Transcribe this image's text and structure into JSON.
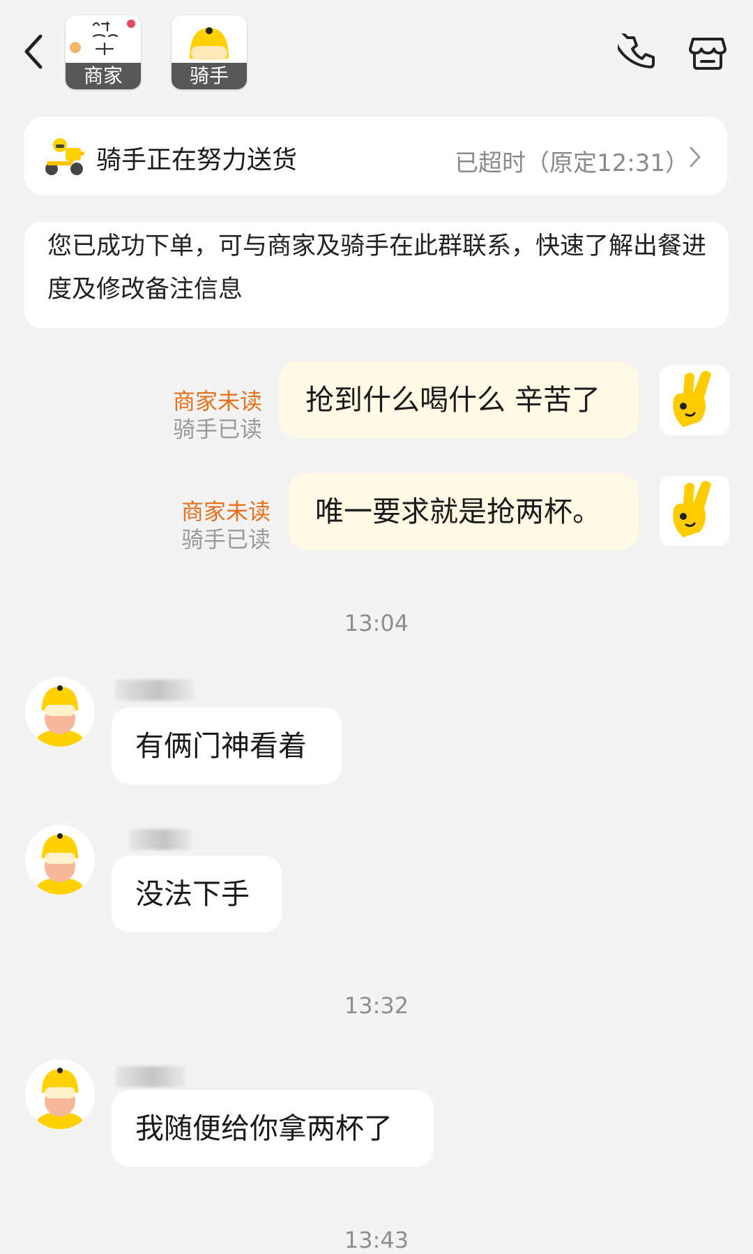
{
  "header": {
    "merchant_tab_label": "商家",
    "merchant_logo_text": "你是我心里的第一位",
    "rider_tab_label": "骑手",
    "icons": [
      "back-icon",
      "phone-icon",
      "store-icon"
    ]
  },
  "status": {
    "title": "骑手正在努力送货",
    "overdue_text": "已超时（原定12:31）",
    "accent_color": "#ffcc00"
  },
  "system_message": "您已成功下单，可与商家及骑手在此群联系，快速了解出餐进度及修改备注信息",
  "messages": [
    {
      "type": "out",
      "text": "抢到什么喝什么 辛苦了",
      "merchant_status": "商家未读",
      "rider_status": "骑手已读"
    },
    {
      "type": "out",
      "text": "唯一要求就是抢两杯。",
      "merchant_status": "商家未读",
      "rider_status": "骑手已读"
    },
    {
      "type": "time",
      "text": "13:04"
    },
    {
      "type": "in",
      "text": "有俩门神看着"
    },
    {
      "type": "in",
      "text": "没法下手"
    },
    {
      "type": "time",
      "text": "13:32"
    },
    {
      "type": "in",
      "text": "我随便给你拿两杯了"
    },
    {
      "type": "time",
      "text": "13:43"
    }
  ],
  "colors": {
    "background": "#f3f3f3",
    "outgoing_bubble": "#fff9e6",
    "unread_status": "#e8701a",
    "read_status": "#9a9a9a",
    "brand_yellow": "#ffcc00"
  }
}
